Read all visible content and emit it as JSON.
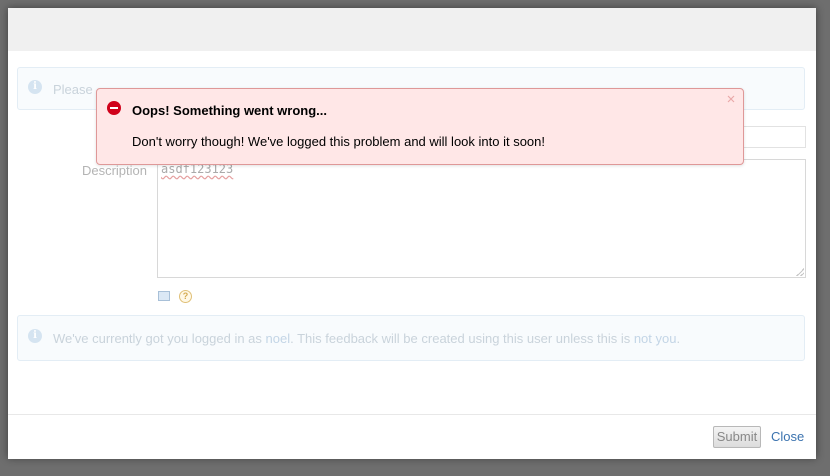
{
  "info_top": {
    "text": "Please"
  },
  "description": {
    "label": "Description",
    "value": "asdf123123"
  },
  "info_bottom": {
    "prefix": "We've currently got you logged in as ",
    "username": "noel",
    "middle": ". This feedback will be created using this user unless this is ",
    "link": "not you",
    "suffix": "."
  },
  "footer": {
    "submit_label": "Submit",
    "close_label": "Close"
  },
  "error": {
    "title": "Oops! Something went wrong...",
    "message": "Don't worry though! We've logged this problem and will look into it soon!"
  },
  "icons": {
    "info": "info-icon",
    "error": "error-icon",
    "help": "help-icon",
    "preview": "preview-icon"
  },
  "colors": {
    "error_bg": "#ffe7e7",
    "error_border": "#df9898",
    "link": "#3b73af"
  }
}
